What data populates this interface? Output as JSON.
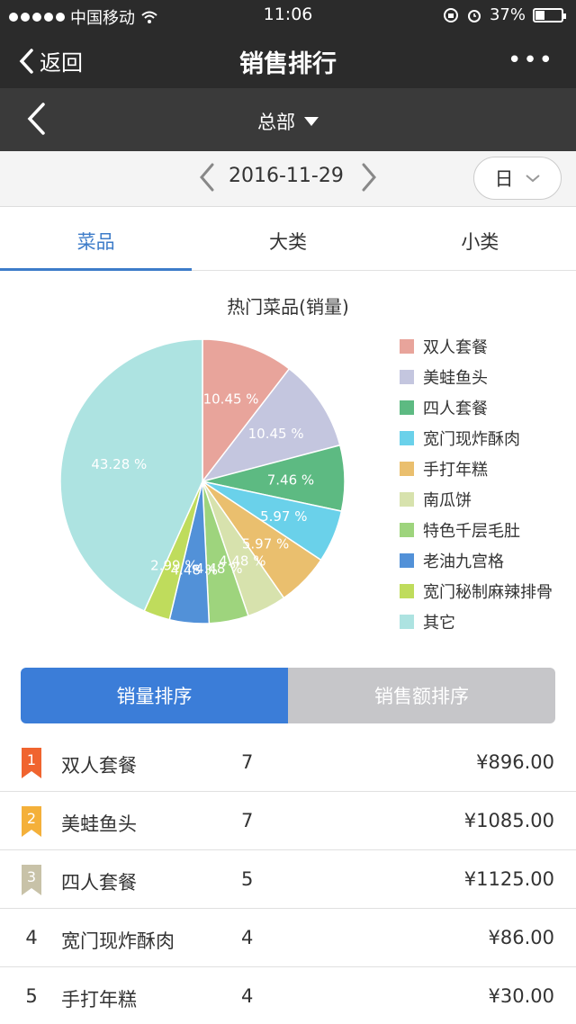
{
  "status": {
    "carrier": "中国移动",
    "time": "11:06",
    "battery": "37%",
    "battery_fraction": 0.37
  },
  "nav": {
    "back_label": "返回",
    "title": "销售排行",
    "more": "•••"
  },
  "org": {
    "name": "总部"
  },
  "date": {
    "value": "2016-11-29",
    "period": "日"
  },
  "tabs": [
    {
      "label": "菜品"
    },
    {
      "label": "大类"
    },
    {
      "label": "小类"
    }
  ],
  "chart_title": "热门菜品(销量)",
  "chart_data": {
    "type": "pie",
    "title": "热门菜品(销量)",
    "legend": "right",
    "slices": [
      {
        "name": "双人套餐",
        "value": 10.45,
        "label": "10.45 %",
        "color": "#e8a49b"
      },
      {
        "name": "美蛙鱼头",
        "value": 10.45,
        "label": "10.45 %",
        "color": "#c4c6df"
      },
      {
        "name": "四人套餐",
        "value": 7.46,
        "label": "7.46 %",
        "color": "#5dba82"
      },
      {
        "name": "宽门现炸酥肉",
        "value": 5.97,
        "label": "5.97 %",
        "color": "#6ad1ea"
      },
      {
        "name": "手打年糕",
        "value": 5.97,
        "label": "5.97 %",
        "color": "#eabf6e"
      },
      {
        "name": "南瓜饼",
        "value": 4.48,
        "label": "4.48 %",
        "color": "#d7e2ad"
      },
      {
        "name": "特色千层毛肚",
        "value": 4.48,
        "label": "4.48 %",
        "color": "#9ed47d"
      },
      {
        "name": "老油九宫格",
        "value": 4.48,
        "label": "4.48 %",
        "color": "#5291d8"
      },
      {
        "name": "宽门秘制麻辣排骨",
        "value": 2.99,
        "label": "2.99 %",
        "color": "#bfdc5c"
      },
      {
        "name": "其它",
        "value": 43.28,
        "label": "43.28 %",
        "color": "#ade3e1"
      }
    ]
  },
  "sort": {
    "by_qty": "销量排序",
    "by_amount": "销售额排序"
  },
  "ranking": [
    {
      "rank": "1",
      "name": "双人套餐",
      "qty": "7",
      "amount": "¥896.00"
    },
    {
      "rank": "2",
      "name": "美蛙鱼头",
      "qty": "7",
      "amount": "¥1085.00"
    },
    {
      "rank": "3",
      "name": "四人套餐",
      "qty": "5",
      "amount": "¥1125.00"
    },
    {
      "rank": "4",
      "name": "宽门现炸酥肉",
      "qty": "4",
      "amount": "¥86.00"
    },
    {
      "rank": "5",
      "name": "手打年糕",
      "qty": "4",
      "amount": "¥30.00"
    }
  ],
  "colors": {
    "accent": "#3b7dd8",
    "rank1": "#f0642f",
    "rank2": "#f4b03a",
    "rank3": "#c8c2a8"
  }
}
